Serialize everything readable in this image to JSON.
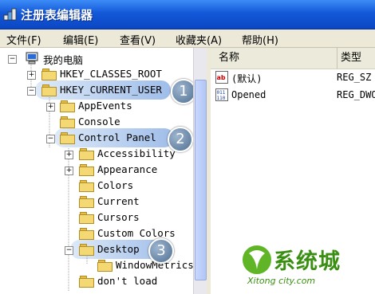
{
  "window": {
    "title": "注册表编辑器"
  },
  "menu": [
    {
      "label": "文件(F)",
      "name": "menu-file"
    },
    {
      "label": "编辑(E)",
      "name": "menu-edit"
    },
    {
      "label": "查看(V)",
      "name": "menu-view"
    },
    {
      "label": "收藏夹(A)",
      "name": "menu-favorites"
    },
    {
      "label": "帮助(H)",
      "name": "menu-help"
    }
  ],
  "tree": {
    "root": "我的电脑",
    "nodes": [
      {
        "label": "HKEY_CLASSES_ROOT",
        "expander": "+"
      },
      {
        "label": "HKEY_CURRENT_USER",
        "expander": "−"
      },
      {
        "label": "AppEvents",
        "expander": "+"
      },
      {
        "label": "Console",
        "expander": ""
      },
      {
        "label": "Control Panel",
        "expander": "−"
      },
      {
        "label": "Accessibility",
        "expander": "+"
      },
      {
        "label": "Appearance",
        "expander": "+"
      },
      {
        "label": "Colors",
        "expander": ""
      },
      {
        "label": "Current",
        "expander": ""
      },
      {
        "label": "Cursors",
        "expander": ""
      },
      {
        "label": "Custom Colors",
        "expander": ""
      },
      {
        "label": "Desktop",
        "expander": "−"
      },
      {
        "label": "WindowMetrics",
        "expander": ""
      },
      {
        "label": "don't load",
        "expander": ""
      }
    ]
  },
  "list": {
    "headers": {
      "name": "名称",
      "type": "类型"
    },
    "rows": [
      {
        "name": "(默认)",
        "type": "REG_SZ",
        "icon": "string-value-icon"
      },
      {
        "name": "Opened",
        "type": "REG_DWORD",
        "icon": "binary-value-icon"
      }
    ]
  },
  "callouts": [
    "1",
    "2",
    "3"
  ],
  "watermark": {
    "text": "系统城",
    "url": "Xitong city.com"
  },
  "colors": {
    "titlebar": "#0b47c4",
    "folder": "#f4d873",
    "highlight": "#5087d7",
    "watermark": "#3a8f12"
  }
}
